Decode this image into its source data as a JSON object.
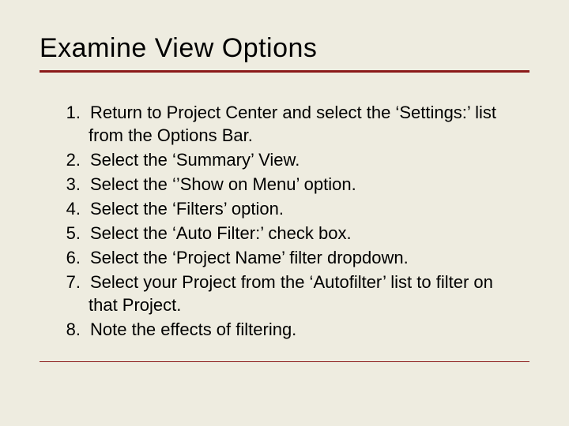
{
  "title": "Examine View Options",
  "steps": [
    "Return to Project Center and select the ‘Settings:’ list from the Options Bar.",
    "Select the ‘Summary’ View.",
    "Select the ‘’Show on Menu’ option.",
    "Select the ‘Filters’ option.",
    "Select the ‘Auto Filter:’ check box.",
    "Select the ‘Project Name’ filter dropdown.",
    "Select your Project from the ‘Autofilter’ list to filter on that Project.",
    "Note the effects of filtering."
  ]
}
